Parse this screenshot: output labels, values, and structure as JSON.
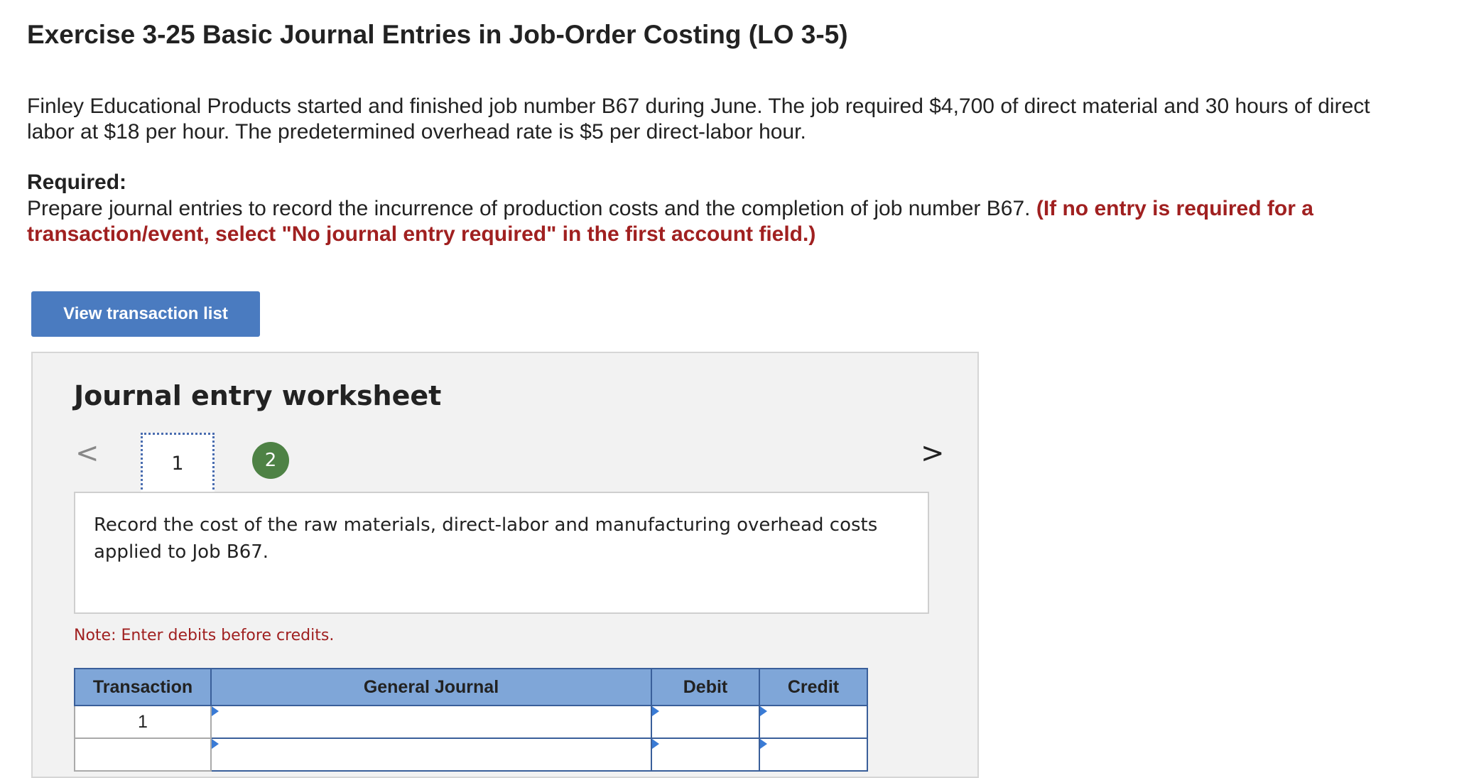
{
  "page": {
    "title": "Exercise 3-25 Basic Journal Entries in Job-Order Costing (LO 3-5)",
    "intro": "Finley Educational Products started and finished job number B67 during June. The job required $4,700 of direct material and 30 hours of direct labor at $18 per hour. The predetermined overhead rate is $5 per direct-labor hour.",
    "required_label": "Required:",
    "required_text": "Prepare journal entries to record the incurrence of production costs and the completion of job number B67.",
    "required_warning": "(If no entry is required for a transaction/event, select \"No journal entry required\" in the first account field.)"
  },
  "buttons": {
    "view_transaction_list": "View transaction list"
  },
  "worksheet": {
    "title": "Journal entry worksheet",
    "steps": [
      "1",
      "2"
    ],
    "active_step": "1",
    "description": "Record the cost of the raw materials, direct-labor and manufacturing overhead costs applied to Job B67.",
    "note": "Note: Enter debits before credits.",
    "nav_prev": "<",
    "nav_next": ">",
    "table": {
      "headers": [
        "Transaction",
        "General Journal",
        "Debit",
        "Credit"
      ],
      "rows": [
        {
          "transaction": "1",
          "account": "",
          "debit": "",
          "credit": ""
        },
        {
          "transaction": "",
          "account": "",
          "debit": "",
          "credit": ""
        }
      ]
    }
  },
  "colors": {
    "button_bg": "#4a7bc0",
    "warning_red": "#a02020",
    "step_completed_green": "#4e8245",
    "table_header_bg": "#7fa6d8"
  }
}
